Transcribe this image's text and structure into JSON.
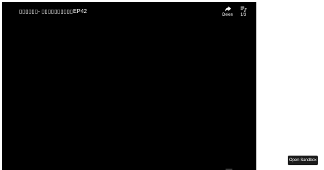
{
  "player": {
    "title": "▯▯▯▯▯▯- ▯▯▯▯▯▯▯▯▯▯EP42",
    "share": {
      "label": "Delen",
      "icon": "share-icon"
    },
    "playlist": {
      "label": "1/3",
      "icon": "playlist-icon"
    },
    "background": "#000000"
  },
  "sandbox_button": {
    "label": "Open Sandbox"
  }
}
